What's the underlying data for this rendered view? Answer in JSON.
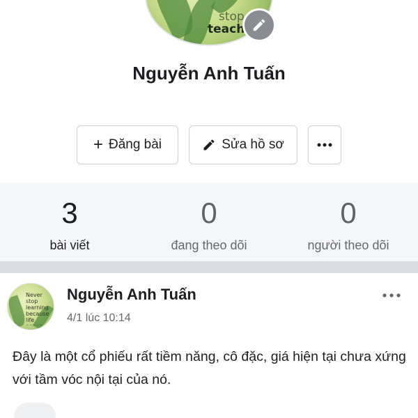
{
  "profile": {
    "name": "Nguyễn Anh Tuấn",
    "avatar_icon": "profile-photo",
    "avatar_text_top": "stop",
    "avatar_text_bottom": "teach",
    "edit_icon": "pencil-icon"
  },
  "actions": {
    "post_icon": "plus-icon",
    "post_label": "Đăng bài",
    "edit_icon": "pencil-icon",
    "edit_label": "Sửa hồ sơ",
    "more_icon": "more-dots-icon"
  },
  "stats": [
    {
      "value": "3",
      "label": "bài viết"
    },
    {
      "value": "0",
      "label": "đang theo dõi"
    },
    {
      "value": "0",
      "label": "người theo dõi"
    }
  ],
  "post": {
    "author": "Nguyễn Anh Tuấn",
    "time": "4/1 lúc 10:14",
    "avatar_text": "Never stop learning because life never stops teaching",
    "text": "Đây là một cổ phiếu rất tiềm năng, cô đặc, giá hiện tại chưa xứng với tầm vóc nội tại của nó.",
    "menu_icon": "more-dots-icon"
  },
  "colors": {
    "stats_band": "#f5f6f7",
    "divider": "#dadde1",
    "muted_text": "#65676b",
    "badge": "#8a8d91"
  }
}
